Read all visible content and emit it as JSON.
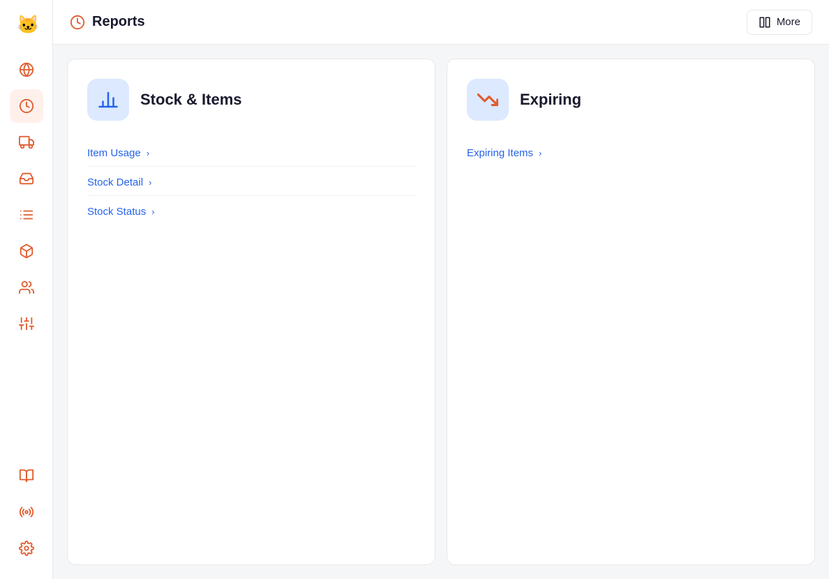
{
  "sidebar": {
    "logo_alt": "App Logo",
    "nav_items": [
      {
        "id": "globe",
        "icon": "globe-icon",
        "active": false
      },
      {
        "id": "reports",
        "icon": "reports-icon",
        "active": true
      },
      {
        "id": "delivery",
        "icon": "delivery-icon",
        "active": false
      },
      {
        "id": "inbox",
        "icon": "inbox-icon",
        "active": false
      },
      {
        "id": "list",
        "icon": "list-icon",
        "active": false
      },
      {
        "id": "box",
        "icon": "box-icon",
        "active": false
      },
      {
        "id": "users",
        "icon": "users-icon",
        "active": false
      },
      {
        "id": "controls",
        "icon": "controls-icon",
        "active": false
      }
    ],
    "bottom_items": [
      {
        "id": "book",
        "icon": "book-icon"
      },
      {
        "id": "radio",
        "icon": "radio-icon"
      },
      {
        "id": "settings",
        "icon": "settings-icon"
      }
    ]
  },
  "header": {
    "title": "Reports",
    "more_button_label": "More",
    "reports_icon_alt": "reports-clock-icon",
    "more_icon_alt": "columns-icon"
  },
  "cards": [
    {
      "id": "stock-items",
      "icon_alt": "bar-chart-icon",
      "title": "Stock & Items",
      "links": [
        {
          "id": "item-usage",
          "label": "Item Usage"
        },
        {
          "id": "stock-detail",
          "label": "Stock Detail"
        },
        {
          "id": "stock-status",
          "label": "Stock Status"
        }
      ]
    },
    {
      "id": "expiring",
      "icon_alt": "trending-down-icon",
      "title": "Expiring",
      "links": [
        {
          "id": "expiring-items",
          "label": "Expiring Items"
        }
      ]
    }
  ]
}
